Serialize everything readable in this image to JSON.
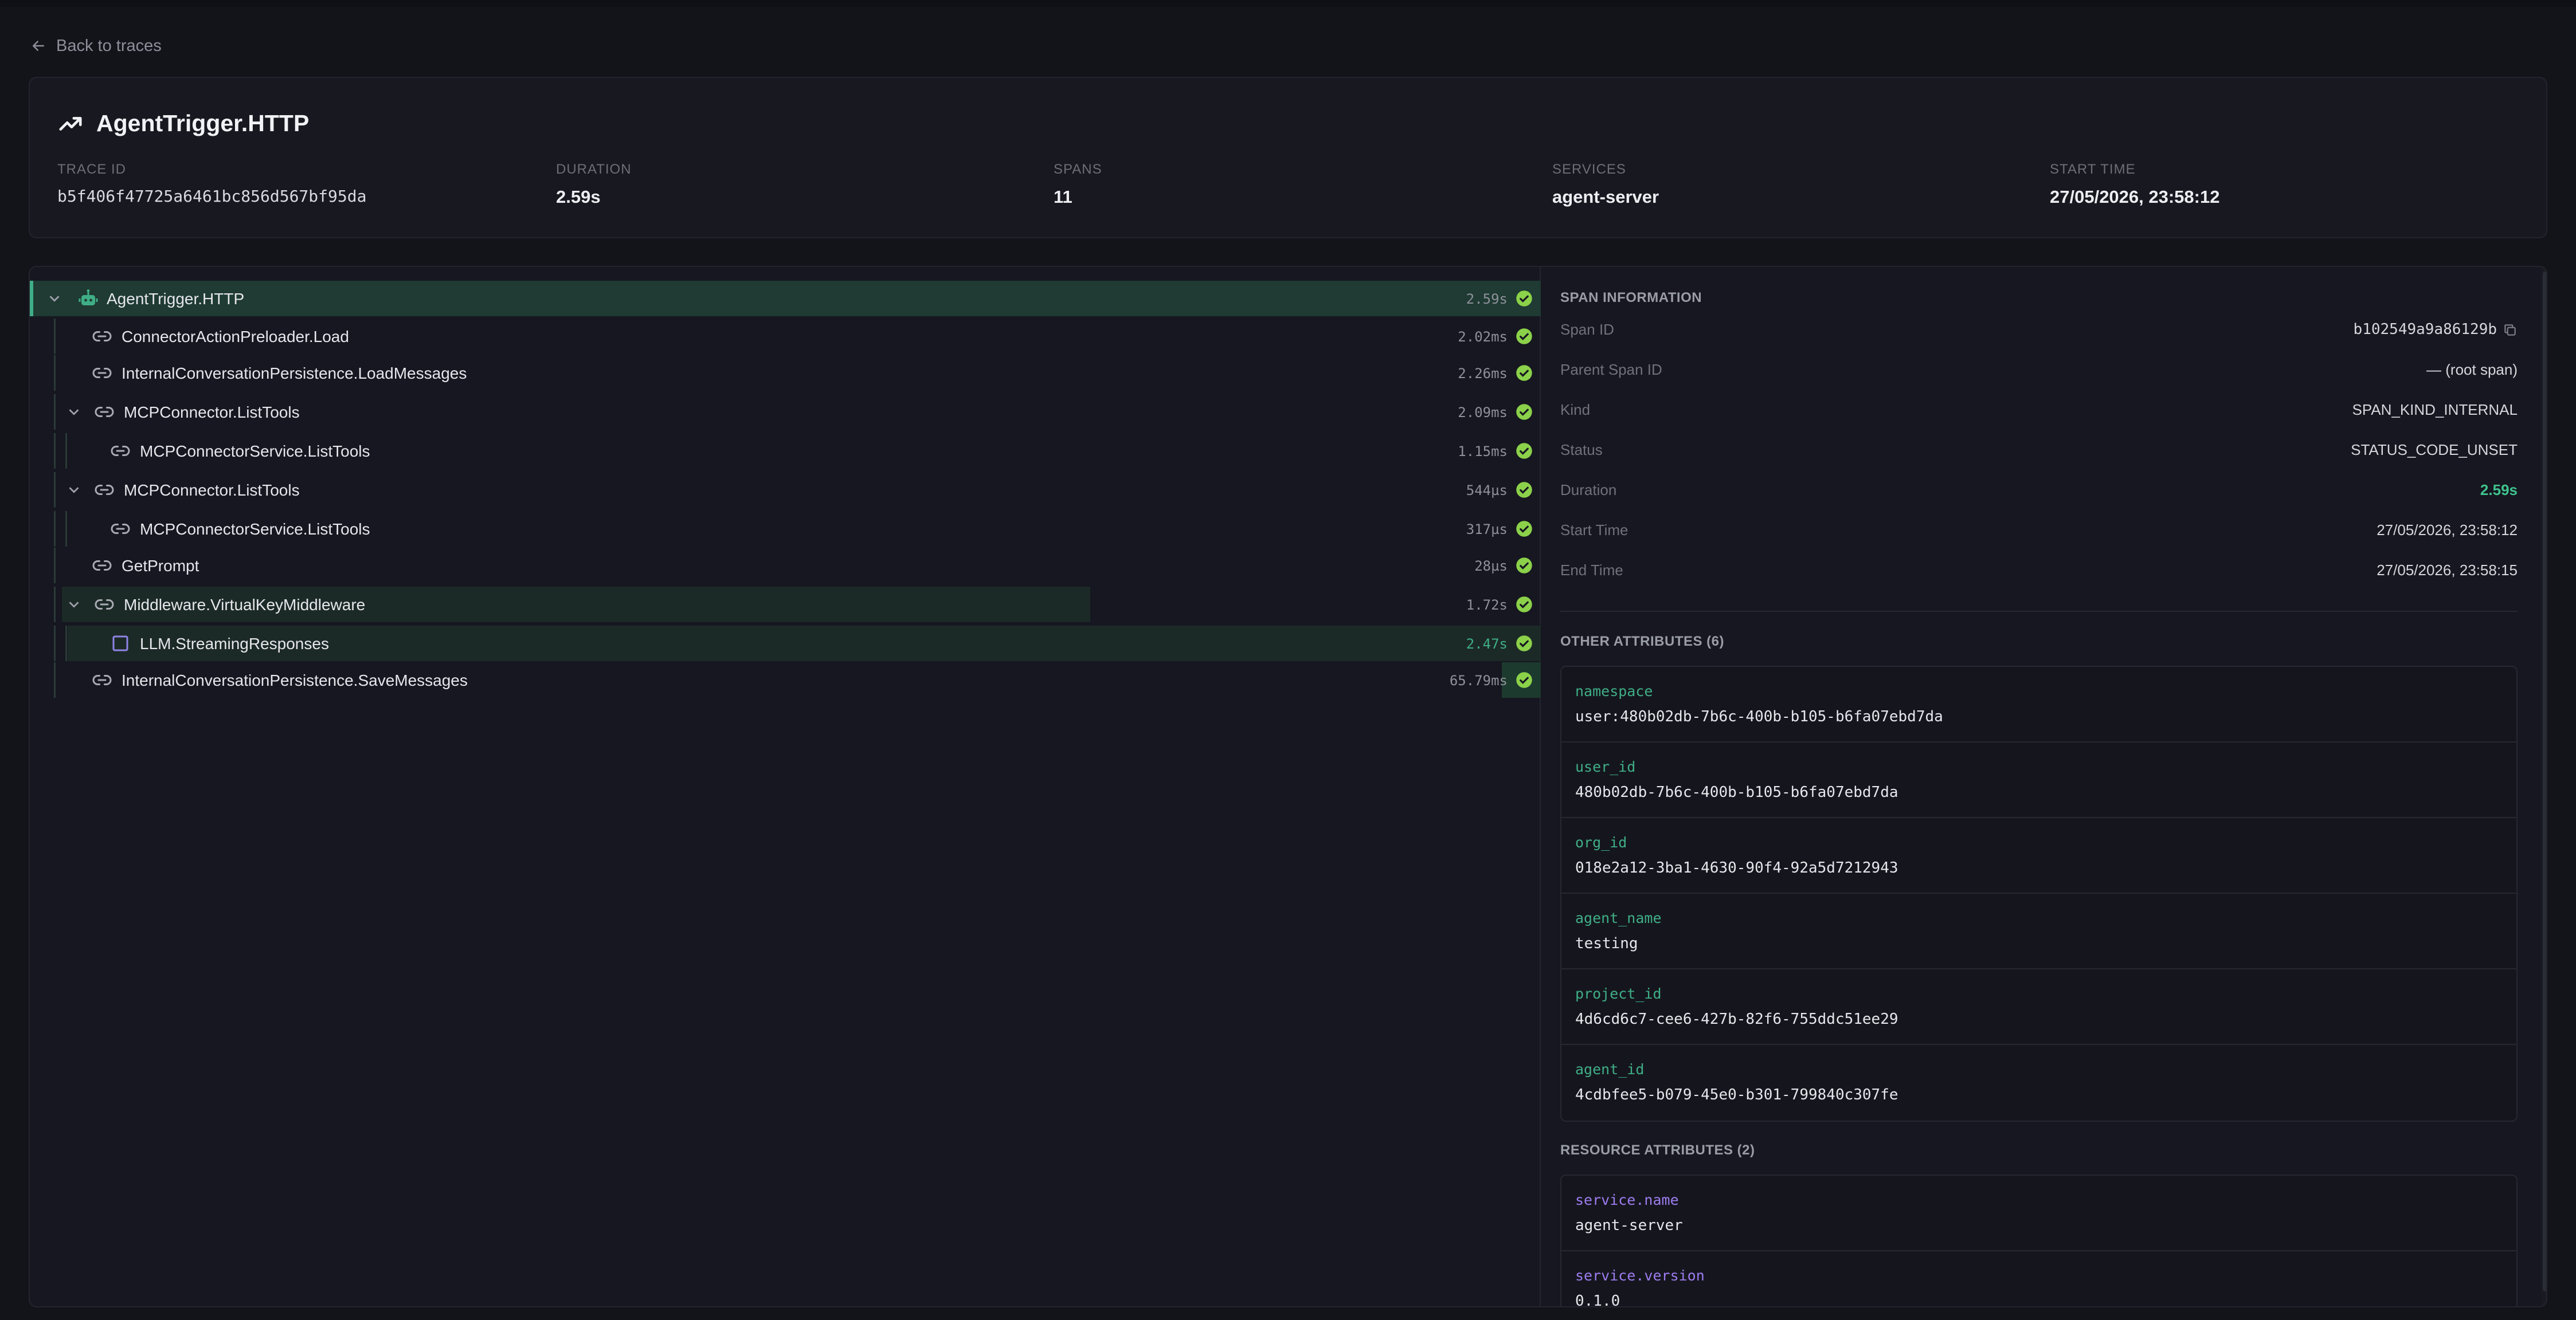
{
  "nav": {
    "back_label": "Back to traces"
  },
  "trace": {
    "title": "AgentTrigger.HTTP",
    "meta": [
      {
        "label": "TRACE ID",
        "value": "b5f406f47725a6461bc856d567bf95da"
      },
      {
        "label": "DURATION",
        "value": "2.59s"
      },
      {
        "label": "SPANS",
        "value": "11"
      },
      {
        "label": "SERVICES",
        "value": "agent-server"
      },
      {
        "label": "START TIME",
        "value": "27/05/2026, 23:58:12"
      }
    ]
  },
  "spans": [
    {
      "name": "AgentTrigger.HTTP",
      "duration": "2.59s",
      "icon": "bot-icon",
      "expanded": true,
      "depth": 0,
      "selected": true
    },
    {
      "name": "ConnectorActionPreloader.Load",
      "duration": "2.02ms",
      "icon": "link-icon",
      "depth": 1
    },
    {
      "name": "InternalConversationPersistence.LoadMessages",
      "duration": "2.26ms",
      "icon": "link-icon",
      "depth": 1
    },
    {
      "name": "MCPConnector.ListTools",
      "duration": "2.09ms",
      "icon": "link-icon",
      "expanded": true,
      "depth": 1
    },
    {
      "name": "MCPConnectorService.ListTools",
      "duration": "1.15ms",
      "icon": "link-icon",
      "depth": 2
    },
    {
      "name": "MCPConnector.ListTools",
      "duration": "544µs",
      "icon": "link-icon",
      "expanded": true,
      "depth": 1
    },
    {
      "name": "MCPConnectorService.ListTools",
      "duration": "317µs",
      "icon": "link-icon",
      "depth": 2
    },
    {
      "name": "GetPrompt",
      "duration": "28µs",
      "icon": "link-icon",
      "depth": 1
    },
    {
      "name": "Middleware.VirtualKeyMiddleware",
      "duration": "1.72s",
      "icon": "link-icon",
      "expanded": true,
      "depth": 1
    },
    {
      "name": "LLM.StreamingResponses",
      "duration": "2.47s",
      "icon": "llm-square-icon",
      "depth": 2
    },
    {
      "name": "InternalConversationPersistence.SaveMessages",
      "duration": "65.79ms",
      "icon": "link-icon",
      "depth": 1
    }
  ],
  "span_info": {
    "title": "SPAN INFORMATION",
    "rows": [
      {
        "key": "Span ID",
        "value": "b102549a9a86129b"
      },
      {
        "key": "Parent Span ID",
        "value": "— (root span)"
      },
      {
        "key": "Kind",
        "value": "SPAN_KIND_INTERNAL"
      },
      {
        "key": "Status",
        "value": "STATUS_CODE_UNSET"
      },
      {
        "key": "Duration",
        "value": "2.59s"
      },
      {
        "key": "Start Time",
        "value": "27/05/2026, 23:58:12"
      },
      {
        "key": "End Time",
        "value": "27/05/2026, 23:58:15"
      }
    ]
  },
  "other_attributes": {
    "title": "OTHER ATTRIBUTES (6)",
    "items": [
      {
        "key": "namespace",
        "value": "user:480b02db-7b6c-400b-b105-b6fa07ebd7da"
      },
      {
        "key": "user_id",
        "value": "480b02db-7b6c-400b-b105-b6fa07ebd7da"
      },
      {
        "key": "org_id",
        "value": "018e2a12-3ba1-4630-90f4-92a5d7212943"
      },
      {
        "key": "agent_name",
        "value": "testing"
      },
      {
        "key": "project_id",
        "value": "4d6cd6c7-cee6-427b-82f6-755ddc51ee29"
      },
      {
        "key": "agent_id",
        "value": "4cdbfee5-b079-45e0-b301-799840c307fe"
      }
    ]
  },
  "resource_attributes": {
    "title": "RESOURCE ATTRIBUTES (2)",
    "items": [
      {
        "key": "service.name",
        "value": "agent-server"
      },
      {
        "key": "service.version",
        "value": "0.1.0"
      }
    ]
  },
  "colors": {
    "accent": "#3fae86",
    "ok": "#8bd14a",
    "resource_key": "#9d7cf0"
  }
}
